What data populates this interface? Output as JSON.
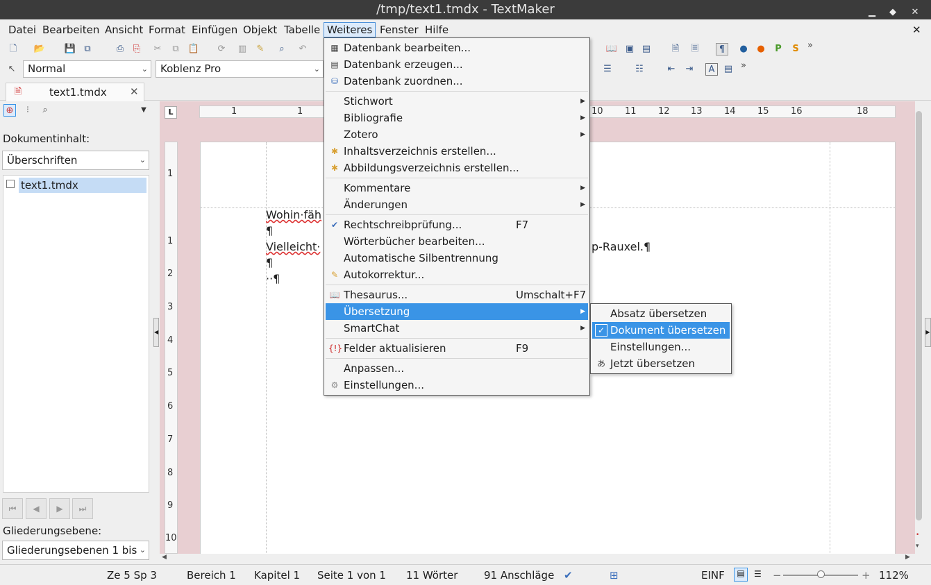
{
  "window": {
    "title": "/tmp/text1.tmdx - TextMaker"
  },
  "menubar": [
    "Datei",
    "Bearbeiten",
    "Ansicht",
    "Format",
    "Einfügen",
    "Objekt",
    "Tabelle",
    "Weiteres",
    "Fenster",
    "Hilfe"
  ],
  "format_toolbar": {
    "style": "Normal",
    "font": "Koblenz Pro"
  },
  "doc_tab": {
    "name": "text1.tmdx"
  },
  "sidebar": {
    "content_label": "Dokumentinhalt:",
    "content_select": "Überschriften",
    "tree_item": "text1.tmdx",
    "level_label": "Gliederungsebene:",
    "level_select": "Gliederungsebenen 1 bis"
  },
  "ruler": {
    "h_labels": [
      "1",
      "1",
      "10",
      "11",
      "12",
      "13",
      "14",
      "15",
      "16",
      "18"
    ],
    "v_labels": [
      "1",
      "1",
      "2",
      "3",
      "4",
      "5",
      "6",
      "7",
      "8",
      "9",
      "10"
    ]
  },
  "document": {
    "line1": "Wohin·fäh",
    "line2": "¶",
    "line3a": "Vielleicht·",
    "line3b": "p-Rauxel.¶",
    "line4": "¶",
    "line5": "··¶"
  },
  "weiteres_menu": [
    {
      "label": "Datenbank bearbeiten...",
      "icon": "db-edit-icon"
    },
    {
      "label": "Datenbank erzeugen...",
      "icon": "db-new-icon"
    },
    {
      "label": "Datenbank zuordnen...",
      "icon": "db-assign-icon"
    },
    {
      "label": "Stichwort",
      "submenu": true
    },
    {
      "label": "Bibliografie",
      "submenu": true
    },
    {
      "label": "Zotero",
      "submenu": true
    },
    {
      "label": "Inhaltsverzeichnis erstellen...",
      "icon": "toc-icon"
    },
    {
      "label": "Abbildungsverzeichnis erstellen...",
      "icon": "figures-icon"
    },
    {
      "label": "Kommentare",
      "submenu": true
    },
    {
      "label": "Änderungen",
      "submenu": true
    },
    {
      "label": "Rechtschreibprüfung...",
      "shortcut": "F7",
      "icon": "spellcheck-icon"
    },
    {
      "label": "Wörterbücher bearbeiten..."
    },
    {
      "label": "Automatische Silbentrennung"
    },
    {
      "label": "Autokorrektur...",
      "icon": "autocorrect-icon"
    },
    {
      "label": "Thesaurus...",
      "shortcut": "Umschalt+F7",
      "icon": "thesaurus-icon"
    },
    {
      "label": "Übersetzung",
      "submenu": true,
      "highlighted": true
    },
    {
      "label": "SmartChat",
      "submenu": true
    },
    {
      "label": "Felder aktualisieren",
      "shortcut": "F9",
      "icon": "fields-icon"
    },
    {
      "label": "Anpassen..."
    },
    {
      "label": "Einstellungen...",
      "icon": "settings-icon"
    }
  ],
  "translation_submenu": [
    {
      "label": "Absatz übersetzen"
    },
    {
      "label": "Dokument übersetzen",
      "checked": true,
      "highlighted": true
    },
    {
      "label": "Einstellungen..."
    },
    {
      "label": "Jetzt übersetzen",
      "icon": "translate-icon"
    }
  ],
  "statusbar": {
    "position": "Ze 5 Sp 3",
    "section": "Bereich 1",
    "chapter": "Kapitel 1",
    "page": "Seite 1 von 1",
    "words": "11 Wörter",
    "chars": "91 Anschläge",
    "mode": "EINF",
    "zoom": "112%"
  },
  "colors": {
    "highlight": "#3a94e6",
    "doc_background": "#e8cfd2",
    "titlebar": "#3b3b3b"
  }
}
